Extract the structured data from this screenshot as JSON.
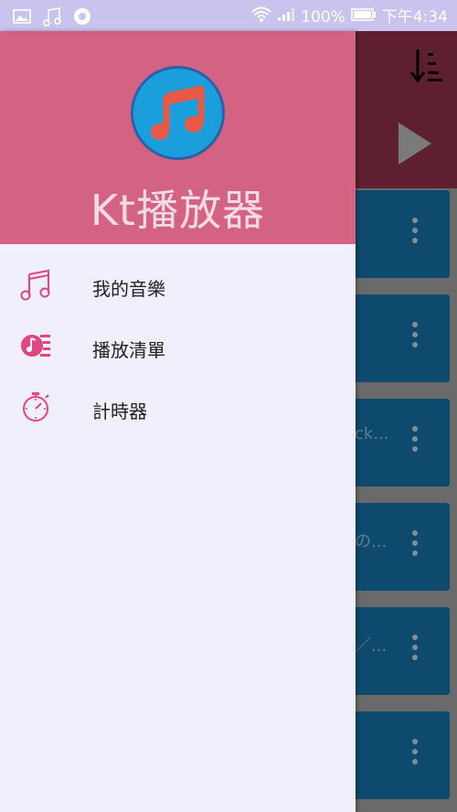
{
  "status_bar": {
    "battery": "100%",
    "time": "下午4:34",
    "icons": [
      "image-icon",
      "music-note-icon",
      "circle-app-icon",
      "wifi-icon",
      "signal-icon",
      "battery-icon"
    ]
  },
  "background": {
    "card_fragments": [
      "",
      "",
      "ck...",
      "の...",
      "／...",
      ""
    ]
  },
  "drawer": {
    "app_title": "Kt播放器",
    "menu": [
      {
        "label": "我的音樂",
        "icon": "music-note-icon"
      },
      {
        "label": "播放清單",
        "icon": "playlist-icon"
      },
      {
        "label": "計時器",
        "icon": "stopwatch-icon"
      }
    ]
  },
  "colors": {
    "accent": "#d46282",
    "drawer_bg": "#f1effb",
    "logo_bg": "#1a9fdc",
    "icon_pink": "#e2457f"
  }
}
